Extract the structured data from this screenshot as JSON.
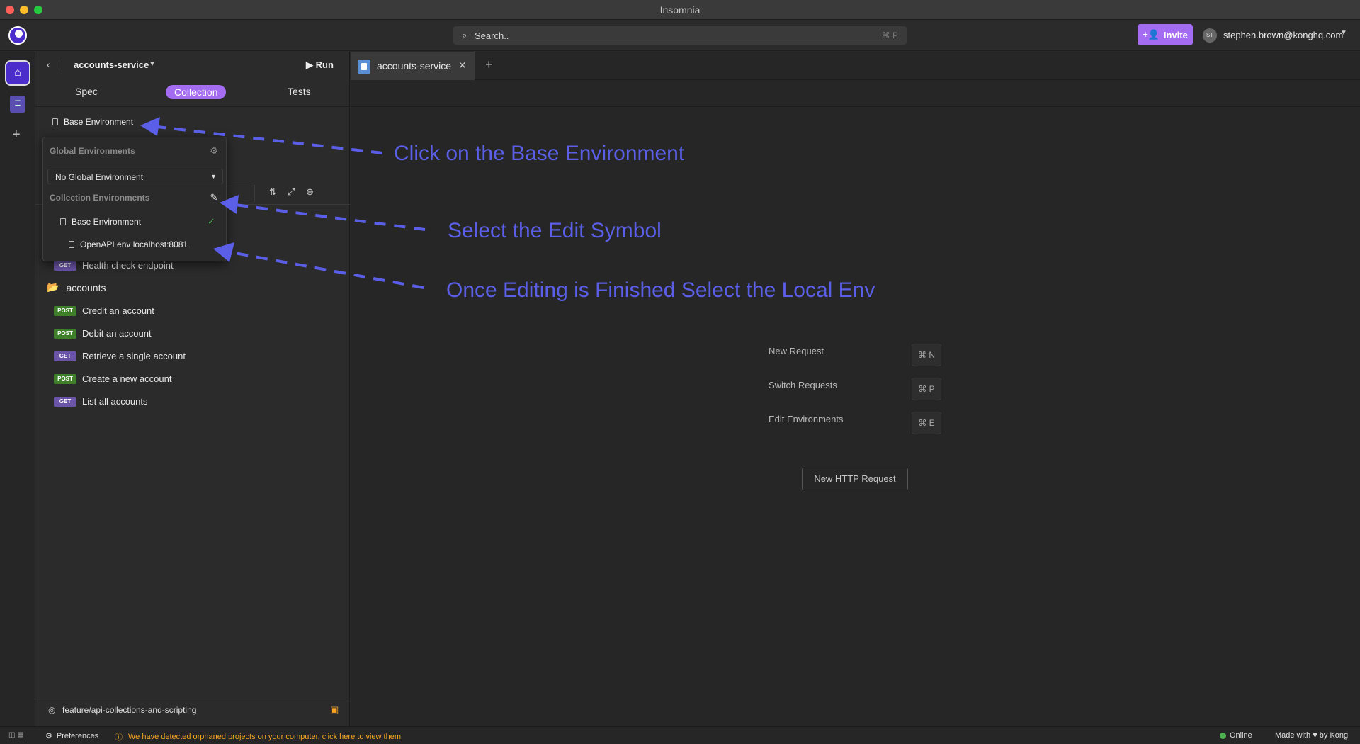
{
  "window": {
    "title": "Insomnia"
  },
  "header": {
    "search_placeholder": "Search..",
    "search_shortcut": "⌘ P",
    "invite_label": "Invite",
    "user_initials": "ST",
    "user_email": "stephen.brown@konghq.com"
  },
  "sidebar": {
    "project_name": "accounts-service",
    "run_label": "Run",
    "tabs": {
      "spec": "Spec",
      "collection": "Collection",
      "tests": "Tests"
    },
    "environment_label": "Base Environment",
    "requests": [
      {
        "method": "GET",
        "label": "Health check endpoint"
      },
      {
        "method": "POST",
        "label": "Credit an account"
      },
      {
        "method": "POST",
        "label": "Debit an account"
      },
      {
        "method": "GET",
        "label": "Retrieve a single account"
      },
      {
        "method": "POST",
        "label": "Create a new account"
      },
      {
        "method": "GET",
        "label": "List all accounts"
      }
    ],
    "folder_label": "accounts",
    "branch": "feature/api-collections-and-scripting"
  },
  "env_dropdown": {
    "global_label": "Global Environments",
    "global_value": "No Global Environment",
    "collection_label": "Collection Environments",
    "items": [
      "Base Environment",
      "OpenAPI env localhost:8081"
    ]
  },
  "tab": {
    "label": "accounts-service"
  },
  "main": {
    "shortcuts": [
      {
        "label": "New Request",
        "key": "⌘ N"
      },
      {
        "label": "Switch Requests",
        "key": "⌘ P"
      },
      {
        "label": "Edit Environments",
        "key": "⌘ E"
      }
    ],
    "new_request_button": "New HTTP Request"
  },
  "annotations": [
    "Click on the Base Environment",
    "Select the Edit Symbol",
    "Once Editing is Finished Select the Local Env"
  ],
  "statusbar": {
    "preferences": "Preferences",
    "warning": "We have detected orphaned projects on your computer, click here to view them.",
    "online": "Online",
    "made_with": "Made with ♥ by Kong"
  },
  "colors": {
    "accent": "#a46cf1",
    "annotation": "#5b5fe8",
    "get": "#6a54a8",
    "post": "#3f7f2a"
  }
}
